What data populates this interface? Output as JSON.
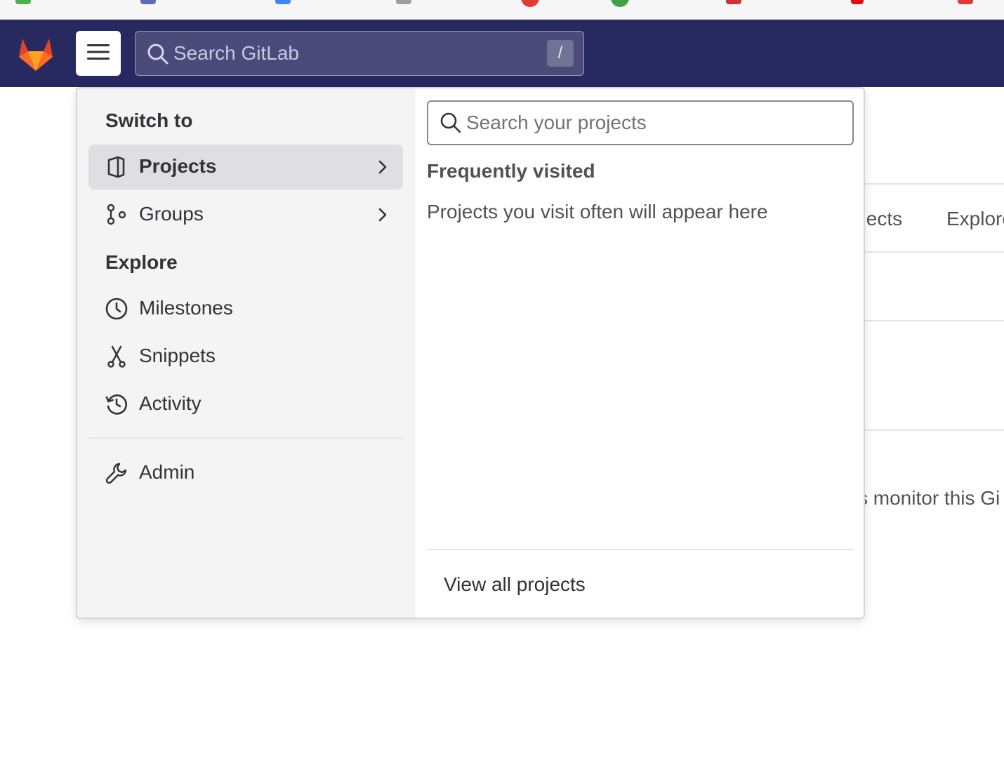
{
  "bookmarks": [
    {
      "icon": "bookmark-icon",
      "color": "#4caf50"
    },
    {
      "icon": "bookmark-icon",
      "color": "#5c6bc0"
    },
    {
      "icon": "bookmark-icon",
      "color": "#4285f4"
    },
    {
      "icon": "bookmark-icon",
      "color": "#9e9e9e"
    },
    {
      "icon": "bookmark-icon",
      "color": "#e53935"
    },
    {
      "icon": "bookmark-icon",
      "color": "#43a047"
    },
    {
      "icon": "bookmark-icon",
      "color": "#d32f2f"
    },
    {
      "icon": "netflix-icon",
      "color": "#e50914"
    },
    {
      "icon": "bookmark-icon",
      "color": "#e53935"
    }
  ],
  "topbar": {
    "background": "#292961",
    "logo_icon": "gitlab-tanuki-icon",
    "menu_icon": "hamburger-menu-icon",
    "search": {
      "placeholder": "Search GitLab",
      "shortcut": "/",
      "icon": "search-icon"
    }
  },
  "background_page": {
    "nav_fragments": [
      "ojects",
      "Explore"
    ],
    "text_fragment": "s monitor this Gi"
  },
  "dropdown": {
    "switch_to": {
      "heading": "Switch to",
      "items": [
        {
          "label": "Projects",
          "icon": "project-icon",
          "active": true,
          "has_submenu": true
        },
        {
          "label": "Groups",
          "icon": "group-icon",
          "active": false,
          "has_submenu": true
        }
      ]
    },
    "explore": {
      "heading": "Explore",
      "items": [
        {
          "label": "Milestones",
          "icon": "clock-icon"
        },
        {
          "label": "Snippets",
          "icon": "snippet-scissors-icon"
        },
        {
          "label": "Activity",
          "icon": "history-icon"
        }
      ]
    },
    "admin": {
      "label": "Admin",
      "icon": "wrench-icon"
    },
    "projects_panel": {
      "search_placeholder": "Search your projects",
      "frequently_visited_heading": "Frequently visited",
      "empty_message": "Projects you visit often will appear here",
      "view_all_label": "View all projects"
    }
  }
}
